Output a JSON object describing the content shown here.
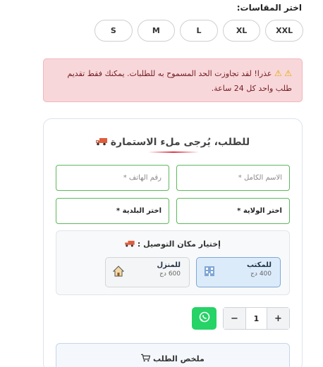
{
  "sizes": {
    "label": "اختر المقاسات:",
    "options": [
      "S",
      "M",
      "L",
      "XL",
      "XXL"
    ]
  },
  "alert": {
    "icon": "⚠️",
    "line1": "عذرا! لقد تجاوزت الحد المسموح به للطلبات. يمكنك فقط تقديم",
    "line2": "طلب واحد كل 24 ساعة."
  },
  "form": {
    "title": "للطلب، يُرجى ملء الاستمارة",
    "title_icon": "truck-icon",
    "fullname_placeholder": "الاسم الكامل *",
    "phone_placeholder": "رقم الهاتف *",
    "wilaya_label": "اختر الولاية *",
    "commune_label": "اختر البلدية *",
    "delivery": {
      "title": "إختيار مكان التوصيل :",
      "office": {
        "label": "للمكتب",
        "price": "400 دج",
        "icon": "office-building-icon"
      },
      "home": {
        "label": "للمنزل",
        "price": "600 دج",
        "icon": "house-icon"
      }
    },
    "quantity": {
      "minus": "−",
      "value": "1",
      "plus": "+"
    },
    "whatsapp_icon": "whatsapp-icon",
    "summary": {
      "title": "ملخص الطلب",
      "icon": "cart-icon"
    }
  },
  "colors": {
    "accent_green": "#5cb85c",
    "whatsapp": "#25d366",
    "alert_bg": "#f8d7da",
    "alert_text": "#721c24",
    "office_selected": "#dcebfa"
  }
}
